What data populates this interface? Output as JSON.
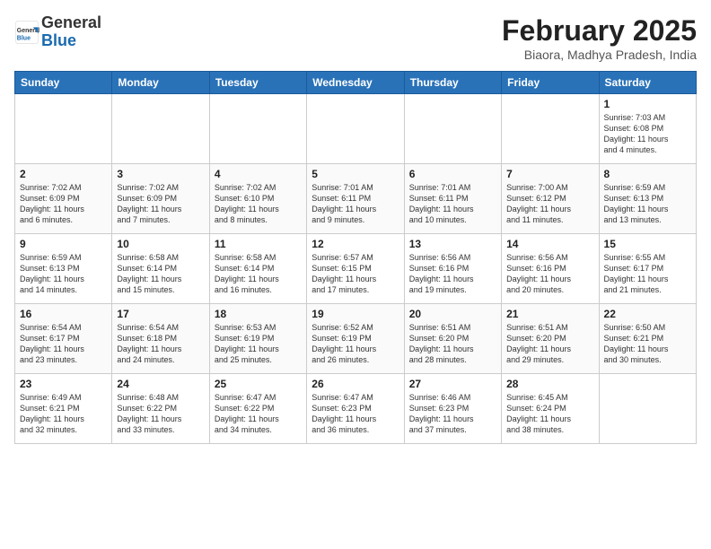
{
  "logo": {
    "general": "General",
    "blue": "Blue"
  },
  "header": {
    "title": "February 2025",
    "subtitle": "Biaora, Madhya Pradesh, India"
  },
  "columns": [
    "Sunday",
    "Monday",
    "Tuesday",
    "Wednesday",
    "Thursday",
    "Friday",
    "Saturday"
  ],
  "weeks": [
    [
      {
        "day": "",
        "info": ""
      },
      {
        "day": "",
        "info": ""
      },
      {
        "day": "",
        "info": ""
      },
      {
        "day": "",
        "info": ""
      },
      {
        "day": "",
        "info": ""
      },
      {
        "day": "",
        "info": ""
      },
      {
        "day": "1",
        "info": "Sunrise: 7:03 AM\nSunset: 6:08 PM\nDaylight: 11 hours\nand 4 minutes."
      }
    ],
    [
      {
        "day": "2",
        "info": "Sunrise: 7:02 AM\nSunset: 6:09 PM\nDaylight: 11 hours\nand 6 minutes."
      },
      {
        "day": "3",
        "info": "Sunrise: 7:02 AM\nSunset: 6:09 PM\nDaylight: 11 hours\nand 7 minutes."
      },
      {
        "day": "4",
        "info": "Sunrise: 7:02 AM\nSunset: 6:10 PM\nDaylight: 11 hours\nand 8 minutes."
      },
      {
        "day": "5",
        "info": "Sunrise: 7:01 AM\nSunset: 6:11 PM\nDaylight: 11 hours\nand 9 minutes."
      },
      {
        "day": "6",
        "info": "Sunrise: 7:01 AM\nSunset: 6:11 PM\nDaylight: 11 hours\nand 10 minutes."
      },
      {
        "day": "7",
        "info": "Sunrise: 7:00 AM\nSunset: 6:12 PM\nDaylight: 11 hours\nand 11 minutes."
      },
      {
        "day": "8",
        "info": "Sunrise: 6:59 AM\nSunset: 6:13 PM\nDaylight: 11 hours\nand 13 minutes."
      }
    ],
    [
      {
        "day": "9",
        "info": "Sunrise: 6:59 AM\nSunset: 6:13 PM\nDaylight: 11 hours\nand 14 minutes."
      },
      {
        "day": "10",
        "info": "Sunrise: 6:58 AM\nSunset: 6:14 PM\nDaylight: 11 hours\nand 15 minutes."
      },
      {
        "day": "11",
        "info": "Sunrise: 6:58 AM\nSunset: 6:14 PM\nDaylight: 11 hours\nand 16 minutes."
      },
      {
        "day": "12",
        "info": "Sunrise: 6:57 AM\nSunset: 6:15 PM\nDaylight: 11 hours\nand 17 minutes."
      },
      {
        "day": "13",
        "info": "Sunrise: 6:56 AM\nSunset: 6:16 PM\nDaylight: 11 hours\nand 19 minutes."
      },
      {
        "day": "14",
        "info": "Sunrise: 6:56 AM\nSunset: 6:16 PM\nDaylight: 11 hours\nand 20 minutes."
      },
      {
        "day": "15",
        "info": "Sunrise: 6:55 AM\nSunset: 6:17 PM\nDaylight: 11 hours\nand 21 minutes."
      }
    ],
    [
      {
        "day": "16",
        "info": "Sunrise: 6:54 AM\nSunset: 6:17 PM\nDaylight: 11 hours\nand 23 minutes."
      },
      {
        "day": "17",
        "info": "Sunrise: 6:54 AM\nSunset: 6:18 PM\nDaylight: 11 hours\nand 24 minutes."
      },
      {
        "day": "18",
        "info": "Sunrise: 6:53 AM\nSunset: 6:19 PM\nDaylight: 11 hours\nand 25 minutes."
      },
      {
        "day": "19",
        "info": "Sunrise: 6:52 AM\nSunset: 6:19 PM\nDaylight: 11 hours\nand 26 minutes."
      },
      {
        "day": "20",
        "info": "Sunrise: 6:51 AM\nSunset: 6:20 PM\nDaylight: 11 hours\nand 28 minutes."
      },
      {
        "day": "21",
        "info": "Sunrise: 6:51 AM\nSunset: 6:20 PM\nDaylight: 11 hours\nand 29 minutes."
      },
      {
        "day": "22",
        "info": "Sunrise: 6:50 AM\nSunset: 6:21 PM\nDaylight: 11 hours\nand 30 minutes."
      }
    ],
    [
      {
        "day": "23",
        "info": "Sunrise: 6:49 AM\nSunset: 6:21 PM\nDaylight: 11 hours\nand 32 minutes."
      },
      {
        "day": "24",
        "info": "Sunrise: 6:48 AM\nSunset: 6:22 PM\nDaylight: 11 hours\nand 33 minutes."
      },
      {
        "day": "25",
        "info": "Sunrise: 6:47 AM\nSunset: 6:22 PM\nDaylight: 11 hours\nand 34 minutes."
      },
      {
        "day": "26",
        "info": "Sunrise: 6:47 AM\nSunset: 6:23 PM\nDaylight: 11 hours\nand 36 minutes."
      },
      {
        "day": "27",
        "info": "Sunrise: 6:46 AM\nSunset: 6:23 PM\nDaylight: 11 hours\nand 37 minutes."
      },
      {
        "day": "28",
        "info": "Sunrise: 6:45 AM\nSunset: 6:24 PM\nDaylight: 11 hours\nand 38 minutes."
      },
      {
        "day": "",
        "info": ""
      }
    ]
  ]
}
